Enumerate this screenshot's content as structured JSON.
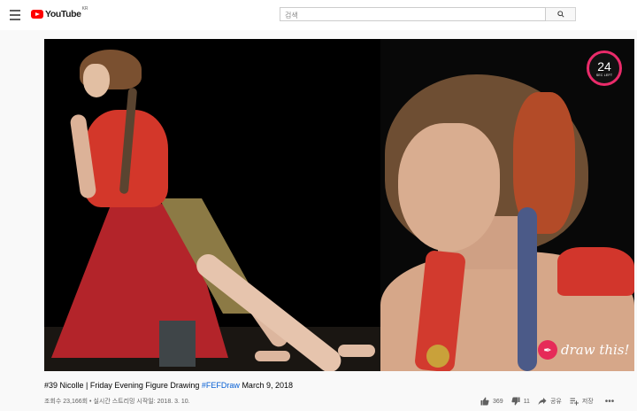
{
  "header": {
    "logo_text": "YouTube",
    "logo_country": "KR",
    "search_placeholder": "검색"
  },
  "player": {
    "timer_value": "24",
    "timer_label": "SEC LEFT",
    "watermark_text": "draw this!"
  },
  "video": {
    "title_main": "#39 Nicolle | Friday Evening Figure Drawing ",
    "title_hashtag": "#FEFDraw",
    "title_date": " March 9, 2018",
    "meta": "조회수 23,166회 • 실시간 스트리밍 시작일: 2018. 3. 10."
  },
  "actions": {
    "likes": "369",
    "dislikes": "11",
    "share_label": "공유",
    "save_label": "저장",
    "more_label": "•••"
  },
  "colors": {
    "brand_red": "#ff0000",
    "timer_ring": "#ea2b6a",
    "hashtag_blue": "#065fd4"
  }
}
